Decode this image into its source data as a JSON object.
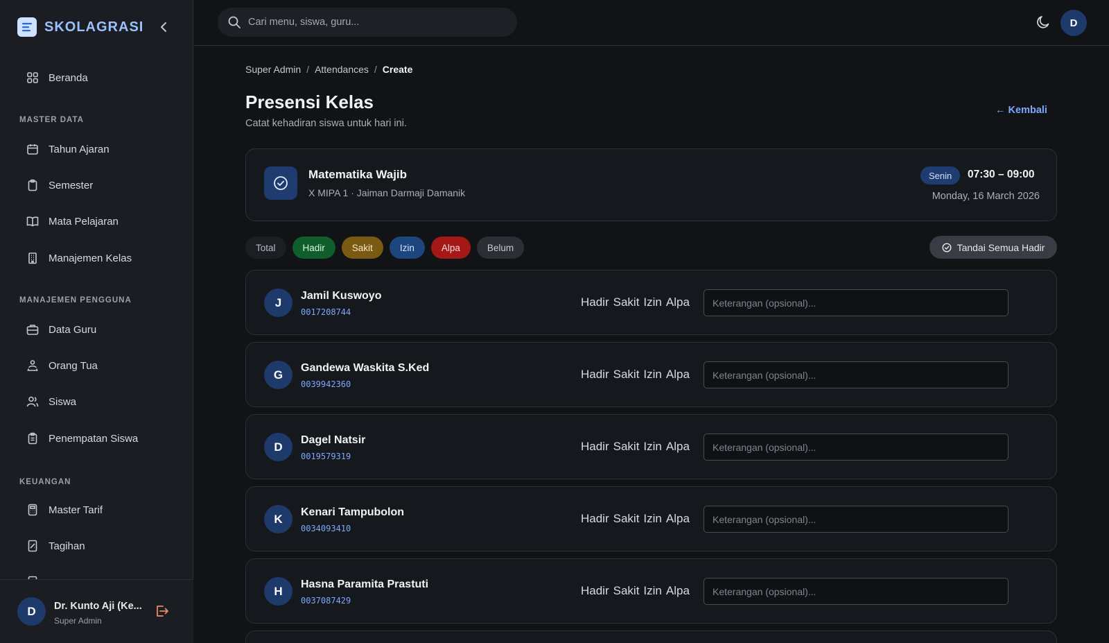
{
  "app": {
    "brand": "SKOLAGRASI"
  },
  "sidebar": {
    "top_items": [
      {
        "label": "Beranda",
        "icon": "grid-icon"
      }
    ],
    "sections": [
      {
        "title": "MASTER DATA",
        "items": [
          {
            "label": "Tahun Ajaran",
            "icon": "calendar-icon"
          },
          {
            "label": "Semester",
            "icon": "clipboard-icon"
          },
          {
            "label": "Mata Pelajaran",
            "icon": "book-icon"
          },
          {
            "label": "Manajemen Kelas",
            "icon": "building-icon"
          }
        ]
      },
      {
        "title": "MANAJEMEN PENGGUNA",
        "items": [
          {
            "label": "Data Guru",
            "icon": "briefcase-icon"
          },
          {
            "label": "Orang Tua",
            "icon": "family-icon"
          },
          {
            "label": "Siswa",
            "icon": "users-icon"
          },
          {
            "label": "Penempatan Siswa",
            "icon": "clipboard-list-icon"
          }
        ]
      },
      {
        "title": "KEUANGAN",
        "items": [
          {
            "label": "Master Tarif",
            "icon": "calculator-icon"
          },
          {
            "label": "Tagihan",
            "icon": "receipt-icon"
          }
        ]
      }
    ],
    "user": {
      "initial": "D",
      "name": "Dr. Kunto Aji (Ke...",
      "role": "Super Admin"
    }
  },
  "topbar": {
    "search_placeholder": "Cari menu, siswa, guru...",
    "avatar_initial": "D"
  },
  "breadcrumb": {
    "items": [
      "Super Admin",
      "Attendances"
    ],
    "current": "Create"
  },
  "page": {
    "title": "Presensi Kelas",
    "subtitle": "Catat kehadiran siswa untuk hari ini.",
    "back_label": "← Kembali"
  },
  "class_info": {
    "subject": "Matematika Wajib",
    "class_name": "X MIPA 1",
    "teacher": "Jaiman Darmaji Damanik",
    "day": "Senin",
    "time": "07:30 – 09:00",
    "date": "Monday, 16 March 2026"
  },
  "summary_chips": {
    "total": "Total",
    "hadir": "Hadir",
    "sakit": "Sakit",
    "izin": "Izin",
    "alpa": "Alpa",
    "belum": "Belum"
  },
  "mark_all_label": "Tandai Semua Hadir",
  "status_options": {
    "hadir": "Hadir",
    "sakit": "Sakit",
    "izin": "Izin",
    "alpa": "Alpa"
  },
  "note_placeholder": "Keterangan (opsional)...",
  "students": [
    {
      "initial": "J",
      "name": "Jamil Kuswoyo",
      "nis": "0017208744"
    },
    {
      "initial": "G",
      "name": "Gandewa Waskita S.Ked",
      "nis": "0039942360"
    },
    {
      "initial": "D",
      "name": "Dagel Natsir",
      "nis": "0019579319"
    },
    {
      "initial": "K",
      "name": "Kenari Tampubolon",
      "nis": "0034093410"
    },
    {
      "initial": "H",
      "name": "Hasna Paramita Prastuti",
      "nis": "0037087429"
    }
  ],
  "colors": {
    "accent": "#7ea8ff",
    "hadir": "#0f5e2c",
    "sakit": "#7a5a12",
    "izin": "#1e467e",
    "alpa": "#a41818"
  }
}
